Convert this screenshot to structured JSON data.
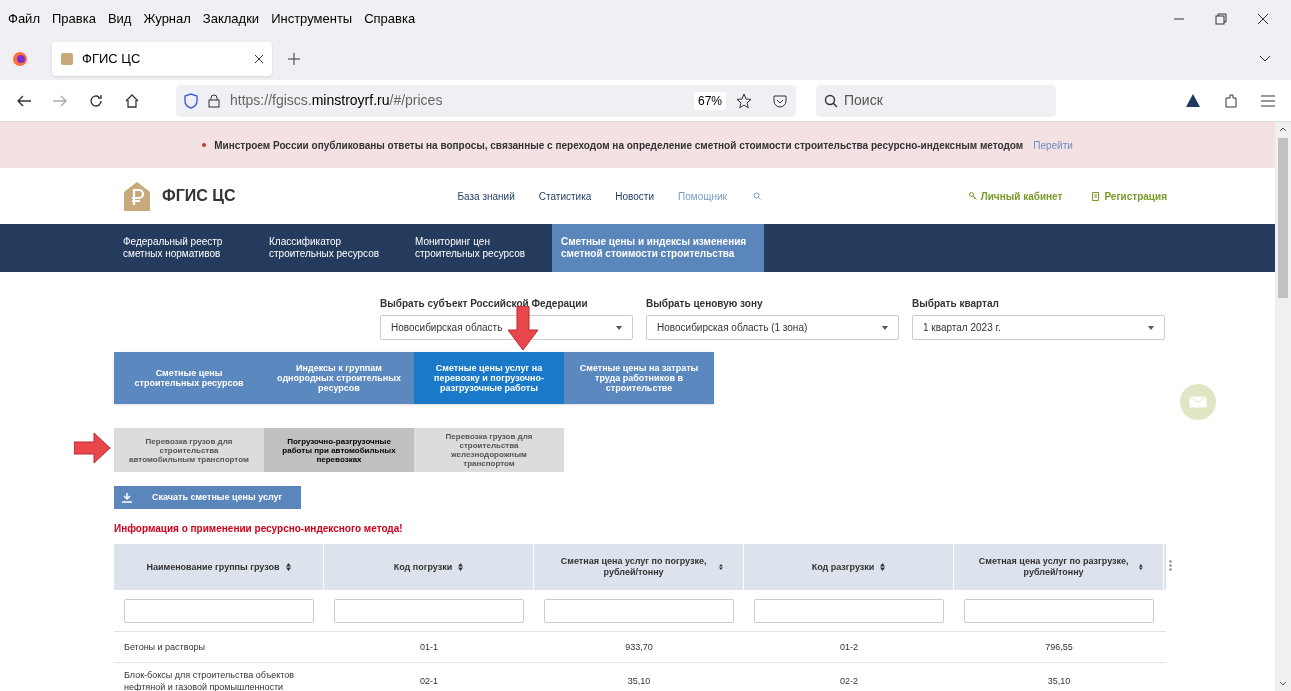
{
  "menu_bar": [
    "Файл",
    "Правка",
    "Вид",
    "Журнал",
    "Закладки",
    "Инструменты",
    "Справка"
  ],
  "browser_tab": {
    "title": "ФГИС ЦС",
    "selected": true
  },
  "address_bar": {
    "url_prefix": "https://fgiscs.",
    "url_domain": "minstroyrf.ru",
    "url_suffix": "/#/prices",
    "zoom": "67%"
  },
  "search": {
    "placeholder": "Поиск"
  },
  "banner": {
    "text": "Минстроем России опубликованы ответы на вопросы, связанные с переходом на определение сметной стоимости строительства ресурсно-индексным методом",
    "link": "Перейти"
  },
  "header": {
    "logo": "ФГИС ЦС",
    "links": [
      {
        "label": "База знаний",
        "selected": false
      },
      {
        "label": "Статистика",
        "selected": false
      },
      {
        "label": "Новости",
        "selected": false
      },
      {
        "label": "Помощник",
        "selected": true
      }
    ],
    "account": "Личный кабинет",
    "register": "Регистрация"
  },
  "main_nav": [
    {
      "label": "Федеральный реестр сметных нормативов",
      "selected": false
    },
    {
      "label": "Классификатор строительных ресурсов",
      "selected": false
    },
    {
      "label": "Мониторинг цен строительных ресурсов",
      "selected": false
    },
    {
      "label": "Сметные цены и индексы изменения сметной стоимости строительства",
      "selected": true
    }
  ],
  "filters": [
    {
      "label": "Выбрать субъект Российской Федерации",
      "value": "Новосибирская область"
    },
    {
      "label": "Выбрать ценовую зону",
      "value": "Новосибирская область (1 зона)"
    },
    {
      "label": "Выбрать квартал",
      "value": "1 квартал 2023 г."
    }
  ],
  "category_tabs": [
    {
      "label": "Сметные цены строительных ресурсов",
      "selected": false
    },
    {
      "label": "Индексы к группам однородных строительных ресурсов",
      "selected": false
    },
    {
      "label": "Сметные цены услуг на перевозку и погрузочно-разгрузочные работы",
      "selected": true
    },
    {
      "label": "Сметные цены на затраты труда работников в строительстве",
      "selected": false
    }
  ],
  "sub_tabs": [
    {
      "label": "Перевозка грузов для строительства автомобильным транспортом",
      "selected": false
    },
    {
      "label": "Погрузочно-разгрузочные работы при автомобильных перевозках",
      "selected": true
    },
    {
      "label": "Перевозка грузов для строительства железнодорожным транспортом",
      "selected": false
    }
  ],
  "download_button": "Скачать сметные цены услуг",
  "info_link": "Информация о применении ресурсно-индексного метода!",
  "table": {
    "columns": [
      "Наименование группы грузов",
      "Код погрузки",
      "Сметная цена услуг по погрузке, рублей/тонну",
      "Код разгрузки",
      "Сметная цена услуг по разгрузке, рублей/тонну"
    ],
    "rows": [
      [
        "Бетоны и растворы",
        "01-1",
        "933,70",
        "01-2",
        "796,55"
      ],
      [
        "Блок-боксы для строительства объектов нефтяной и газовой промышленности",
        "02-1",
        "35,10",
        "02-2",
        "35,10"
      ]
    ]
  }
}
